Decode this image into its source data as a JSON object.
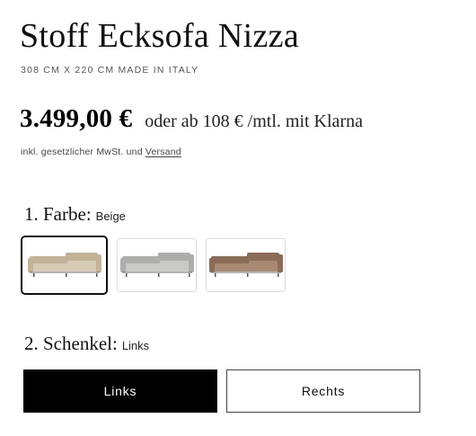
{
  "product": {
    "title": "Stoff Ecksofa Nizza",
    "subtitle": "308 CM X 220 CM MADE IN ITALY"
  },
  "pricing": {
    "price": "3.499,00 €",
    "klarna_text": "oder ab 108 € /mtl. mit Klarna",
    "tax_text": "inkl. gesetzlicher MwSt. und",
    "shipping_link": "Versand"
  },
  "color_option": {
    "label": "1. Farbe:",
    "selected": "Beige",
    "swatches": [
      {
        "name": "Beige",
        "color": "#d8cbb6",
        "shade": "#c2b398",
        "active": true,
        "icon": "sofa-beige-thumbnail"
      },
      {
        "name": "Grau",
        "color": "#c9c9c7",
        "shade": "#adadab",
        "active": false,
        "icon": "sofa-grey-thumbnail"
      },
      {
        "name": "Braun",
        "color": "#a88a74",
        "shade": "#8a6c58",
        "active": false,
        "icon": "sofa-brown-thumbnail"
      }
    ]
  },
  "leg_option": {
    "label": "2. Schenkel:",
    "selected": "Links",
    "buttons": [
      {
        "label": "Links",
        "active": true
      },
      {
        "label": "Rechts",
        "active": false
      }
    ]
  }
}
